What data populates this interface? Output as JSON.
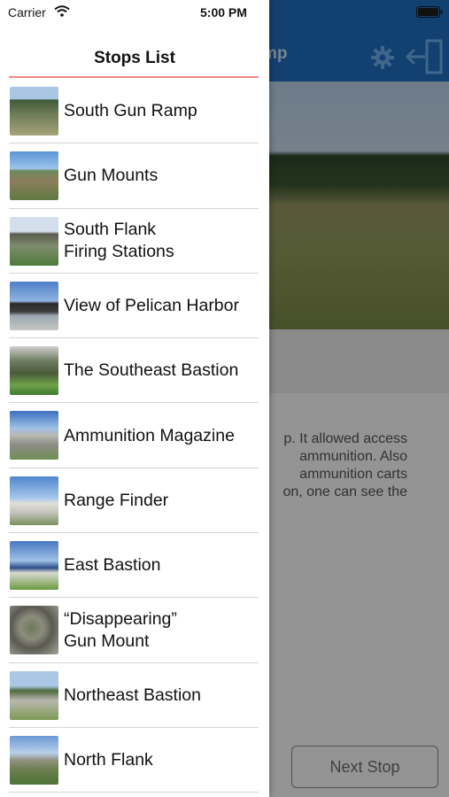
{
  "status_bar": {
    "carrier": "Carrier",
    "time": "5:00 PM"
  },
  "background": {
    "nav_title": "mp",
    "description": "p. It allowed access\n ammunition. Also\n ammunition carts\non, one can see the",
    "next_button_label": "Next Stop"
  },
  "drawer": {
    "title": "Stops List",
    "accent_color": "#f08a84",
    "stops": [
      {
        "label": "South Gun Ramp",
        "thumb": "t1"
      },
      {
        "label": "Gun Mounts",
        "thumb": "t2"
      },
      {
        "label": "South Flank\nFiring Stations",
        "thumb": "t3"
      },
      {
        "label": "View of Pelican Harbor",
        "thumb": "t4"
      },
      {
        "label": "The Southeast Bastion",
        "thumb": "t5"
      },
      {
        "label": "Ammunition Magazine",
        "thumb": "t6"
      },
      {
        "label": "Range Finder",
        "thumb": "t7"
      },
      {
        "label": "East Bastion",
        "thumb": "t8"
      },
      {
        "label": "“Disappearing”\nGun Mount",
        "thumb": "t9"
      },
      {
        "label": "Northeast Bastion",
        "thumb": "t10"
      },
      {
        "label": "North Flank",
        "thumb": "t11"
      }
    ]
  },
  "icons": {
    "wifi": "wifi-icon",
    "battery": "battery-icon",
    "settings": "gear-icon",
    "exit": "exit-door-icon"
  }
}
